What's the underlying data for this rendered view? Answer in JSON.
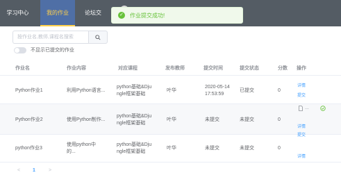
{
  "nav": {
    "items": [
      {
        "label": "学习中心"
      },
      {
        "label": "我的作业"
      },
      {
        "label": "论坛交"
      }
    ]
  },
  "toast": {
    "message": "作业提交成功!"
  },
  "search": {
    "placeholder": "按作业名,教师,课程名搜索"
  },
  "filter": {
    "label": "不显示已提交的作业"
  },
  "table": {
    "headers": [
      "作业名",
      "作业内容",
      "对应课程",
      "发布教师",
      "提交时间",
      "提交状态",
      "分数",
      "操作"
    ],
    "rows": [
      {
        "name": "Python作业1",
        "content": "利用Python语言...",
        "course1": "python基础&Dju",
        "course2": "ngle框架基础",
        "teacher": "叶华",
        "time1": "2020-05-14",
        "time2": "17:53:59",
        "status": "已提交",
        "score": "0",
        "actions": [
          "详情",
          "提交"
        ]
      },
      {
        "name": "Python作业2",
        "content": "使用Python制作...",
        "course1": "python基础&Dju",
        "course2": "ngle框架基础",
        "teacher": "叶华",
        "time1": "未提交",
        "time2": "",
        "status": "未提交",
        "score": "0",
        "actions": [
          "详情",
          "提交"
        ]
      },
      {
        "name": "python作业3",
        "content": "使用python中",
        "content2": "的...",
        "course1": "python基础&Dju",
        "course2": "ngle框架基础",
        "teacher": "叶华",
        "time1": "未提交",
        "time2": "",
        "status": "未提交",
        "score": "0",
        "actions": [
          "详情"
        ]
      }
    ],
    "upload_file": "..."
  },
  "pager": {
    "prev": "<",
    "page": "1",
    "next": ">"
  },
  "colors": {
    "nav_bg": "#545c64",
    "active_text": "#ffd04b",
    "success": "#67c23a",
    "link": "#409eff"
  }
}
